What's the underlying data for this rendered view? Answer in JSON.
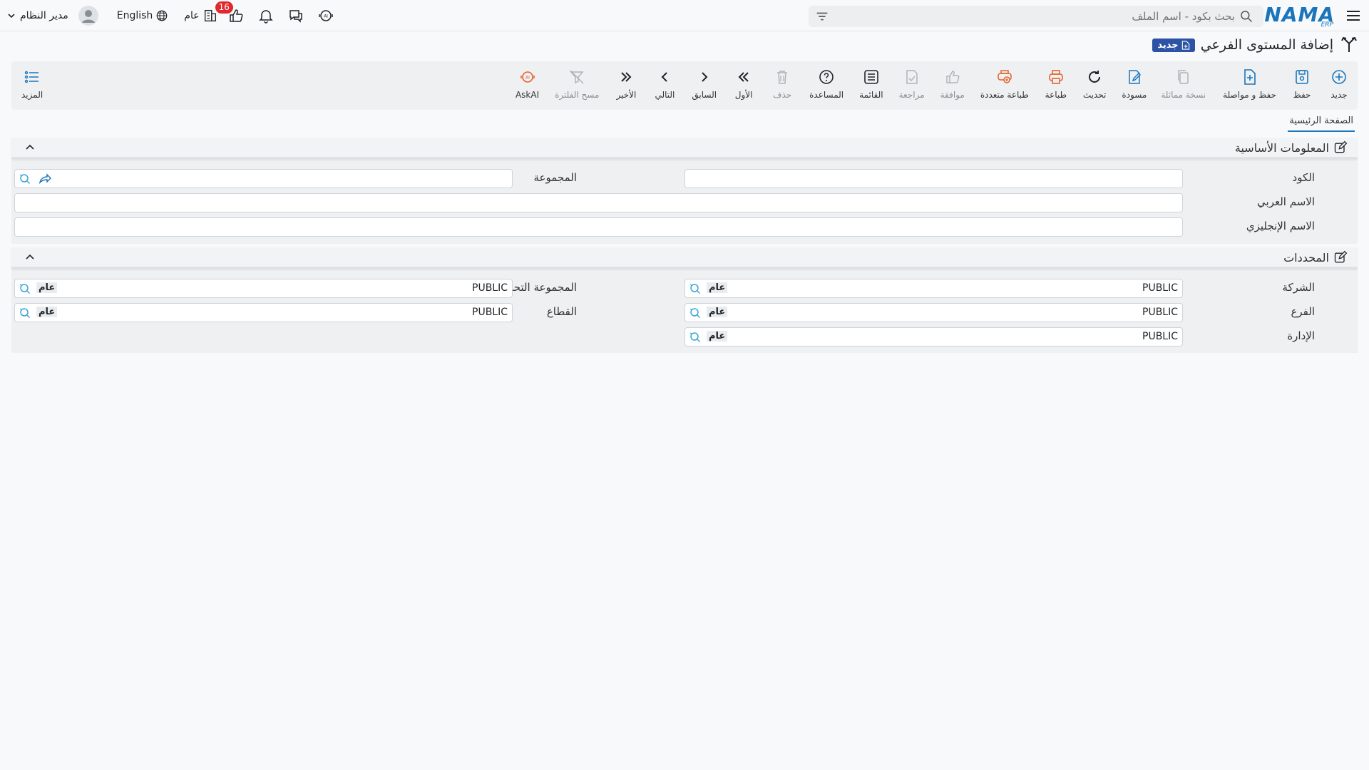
{
  "header": {
    "search_placeholder": "بحث بكود - اسم الملف",
    "user_name": "مدير النظام",
    "language": "English",
    "branch_label": "عام",
    "notification_count": "16"
  },
  "logo": {
    "name": "NAMA",
    "sub": "ERP"
  },
  "page": {
    "title": "إضافة المستوى الفرعي",
    "status_badge": "جديد"
  },
  "toolbar": {
    "items": [
      {
        "label": "جديد",
        "icon": "plus-circle-icon",
        "color": "#1a75bb",
        "disabled": false
      },
      {
        "label": "حفظ",
        "icon": "save-icon",
        "color": "#1a75bb",
        "disabled": false
      },
      {
        "label": "حفظ و مواصلة",
        "icon": "save-continue-icon",
        "color": "#1a75bb",
        "disabled": false
      },
      {
        "label": "نسخة مماثلة",
        "icon": "copy-icon",
        "color": "#b0b4b8",
        "disabled": true
      },
      {
        "label": "مسودة",
        "icon": "draft-icon",
        "color": "#1a75bb",
        "disabled": false
      },
      {
        "label": "تحديث",
        "icon": "refresh-icon",
        "color": "#212529",
        "disabled": false
      },
      {
        "label": "طباعة",
        "icon": "print-icon",
        "color": "#e8612c",
        "disabled": false
      },
      {
        "label": "طباعة متعددة",
        "icon": "multi-print-icon",
        "color": "#e8612c",
        "disabled": false
      },
      {
        "label": "موافقة",
        "icon": "thumbs-up-icon",
        "color": "#b0b4b8",
        "disabled": true
      },
      {
        "label": "مراجعة",
        "icon": "review-icon",
        "color": "#b0b4b8",
        "disabled": true
      },
      {
        "label": "القائمة",
        "icon": "list-icon",
        "color": "#212529",
        "disabled": false
      },
      {
        "label": "المساعدة",
        "icon": "help-icon",
        "color": "#212529",
        "disabled": false
      },
      {
        "label": "حذف",
        "icon": "trash-icon",
        "color": "#b0b4b8",
        "disabled": true
      },
      {
        "label": "الأول",
        "icon": "first-icon",
        "color": "#212529",
        "disabled": false
      },
      {
        "label": "السابق",
        "icon": "previous-icon",
        "color": "#212529",
        "disabled": false
      },
      {
        "label": "التالي",
        "icon": "next-icon",
        "color": "#212529",
        "disabled": false
      },
      {
        "label": "الأخير",
        "icon": "last-icon",
        "color": "#212529",
        "disabled": false
      },
      {
        "label": "مسح الفلترة",
        "icon": "clear-filter-icon",
        "color": "#b0b4b8",
        "disabled": true
      },
      {
        "label": "AskAI",
        "icon": "ask-ai-icon",
        "color": "#e8612c",
        "disabled": false
      }
    ],
    "more_label": "المزيد"
  },
  "tabs": [
    {
      "label": "الصفحة الرئيسية",
      "active": true
    }
  ],
  "basic_info": {
    "title": "المعلومات الأساسية",
    "code_label": "الكود",
    "code_value": "",
    "group_label": "المجموعة",
    "group_value": "",
    "arabic_name_label": "الاسم العربي",
    "arabic_name_value": "",
    "english_name_label": "الاسم الإنجليزي",
    "english_name_value": ""
  },
  "dimensions": {
    "title": "المحددات",
    "company_label": "الشركة",
    "company_value": "PUBLIC",
    "company_sub": "عام",
    "branch_label": "الفرع",
    "branch_value": "PUBLIC",
    "branch_sub": "عام",
    "department_label": "الإدارة",
    "department_value": "PUBLIC",
    "department_sub": "عام",
    "analysis_group_label": "المجموعة التحليلية",
    "analysis_group_value": "PUBLIC",
    "analysis_group_sub": "عام",
    "sector_label": "القطاع",
    "sector_value": "PUBLIC",
    "sector_sub": "عام"
  },
  "colors": {
    "accent": "#1a75bb",
    "badge_blue": "#2d53a5",
    "print_orange": "#e8612c",
    "notification_red": "#e0282e"
  }
}
